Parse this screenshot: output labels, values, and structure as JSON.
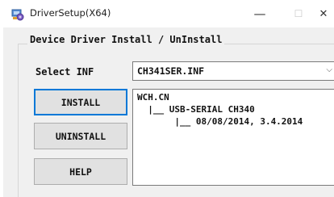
{
  "window": {
    "title": "DriverSetup(X64)",
    "controls": {
      "minimize": "—",
      "maximize": "☐",
      "close": "✕"
    }
  },
  "group": {
    "title": "Device Driver Install / UnInstall"
  },
  "select_inf": {
    "label": "Select INF",
    "value": "CH341SER.INF",
    "arrow": "⌵"
  },
  "buttons": {
    "install": "INSTALL",
    "uninstall": "UNINSTALL",
    "help": "HELP"
  },
  "info": {
    "lines": [
      "WCH.CN",
      "  |__ USB-SERIAL CH340",
      "       |__ 08/08/2014, 3.4.2014"
    ]
  }
}
